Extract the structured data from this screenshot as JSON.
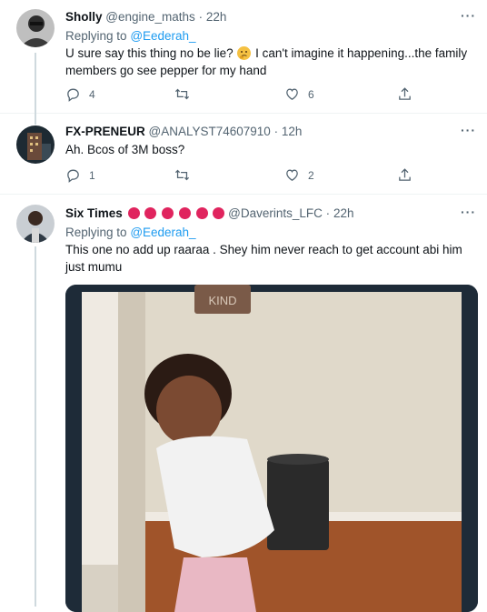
{
  "tweets": [
    {
      "name": "Sholly",
      "handle": "@engine_maths",
      "time": "22h",
      "replying_label": "Replying to",
      "replying_handle": "@Eederah_",
      "text_part1": "U sure say this thing no be lie?",
      "text_part2": "I can't imagine it happening...the family members go see pepper for my hand",
      "replies": "4",
      "retweets": "",
      "likes": "6"
    },
    {
      "name": "FX-PRENEUR",
      "handle": "@ANALYST74607910",
      "time": "12h",
      "text": "Ah. Bcos of 3M boss?",
      "replies": "1",
      "retweets": "",
      "likes": "2"
    },
    {
      "name": "Six Times",
      "handle": "@Daverints_LFC",
      "time": "22h",
      "replying_label": "Replying to",
      "replying_handle": "@Eederah_",
      "text": "This one no add up raaraa . Shey him never reach to get account abi him just mumu",
      "media_sign": "KIND"
    }
  ],
  "separator": "·",
  "more_glyph": "···",
  "colors": {
    "accent": "#1d9bf0",
    "muted": "#536471",
    "badge_red": "#e0245e",
    "divider": "#eff3f4"
  },
  "icons": [
    "reply-icon",
    "retweet-icon",
    "like-icon",
    "share-icon",
    "more-icon",
    "thinking-emoji-icon",
    "red-circle-icon"
  ]
}
